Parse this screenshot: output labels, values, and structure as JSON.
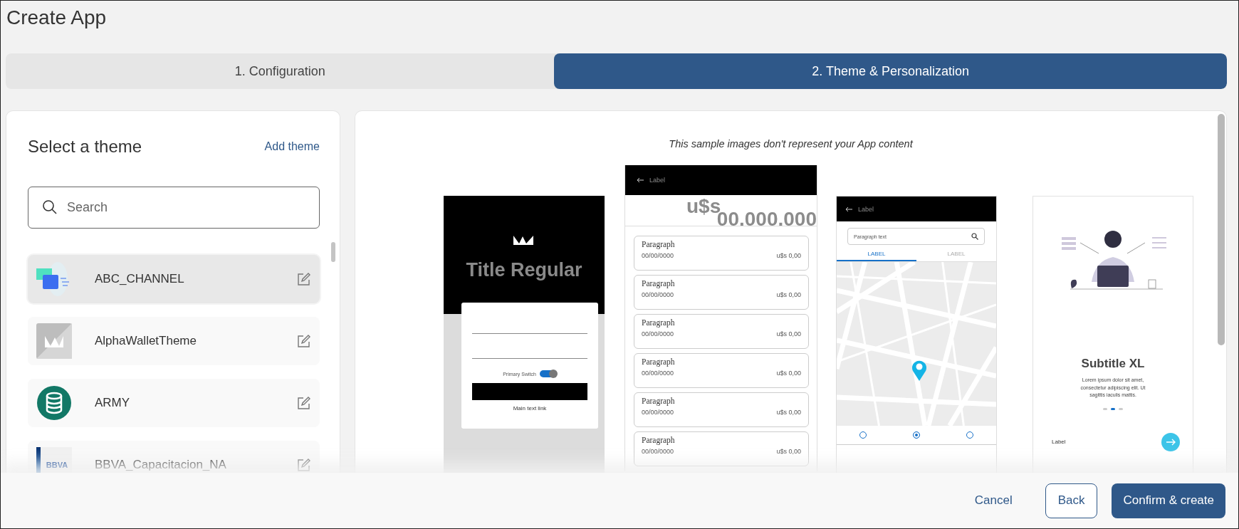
{
  "title": "Create App",
  "steps": [
    {
      "label": "1. Configuration",
      "selected": false
    },
    {
      "label": "2. Theme & Personalization",
      "selected": true
    }
  ],
  "theme_panel": {
    "heading": "Select a theme",
    "add_link": "Add theme",
    "search": {
      "placeholder": "Search"
    },
    "themes": [
      {
        "name": "ABC_CHANNEL",
        "kind": "cards",
        "selected": true
      },
      {
        "name": "AlphaWalletTheme",
        "kind": "crown",
        "selected": false
      },
      {
        "name": "ARMY",
        "kind": "database",
        "selected": false
      },
      {
        "name": "BBVA_Capacitacion_NA",
        "kind": "logo",
        "logo_text": "BBVA",
        "selected": false
      }
    ]
  },
  "preview": {
    "caption": "This sample images don't represent your App content",
    "screens": [
      {
        "kind": "login",
        "title": "Title Regular",
        "switch_label": "Primary Switch",
        "switch_on": true,
        "link": "Main text link"
      },
      {
        "kind": "list",
        "header": "Label",
        "currency": "u$s",
        "amount": "00.000.000",
        "rows": [
          {
            "title": "Paragraph",
            "date": "00/00/0000",
            "value": "u$s 0,00"
          },
          {
            "title": "Paragraph",
            "date": "00/00/0000",
            "value": "u$s 0,00"
          },
          {
            "title": "Paragraph",
            "date": "00/00/0000",
            "value": "u$s 0,00"
          },
          {
            "title": "Paragraph",
            "date": "00/00/0000",
            "value": "u$s 0,00"
          },
          {
            "title": "Paragraph",
            "date": "00/00/0000",
            "value": "u$s 0,00"
          },
          {
            "title": "Paragraph",
            "date": "00/00/0000",
            "value": "u$s 0,00"
          }
        ]
      },
      {
        "kind": "map",
        "header": "Label",
        "search_placeholder": "Paragraph text",
        "tabs": [
          {
            "label": "LABEL",
            "selected": true
          },
          {
            "label": "LABEL",
            "selected": false
          }
        ],
        "nav": [
          {
            "selected": false
          },
          {
            "selected": true
          },
          {
            "selected": false
          }
        ]
      },
      {
        "kind": "onboarding",
        "subtitle": "Subtitle XL",
        "text": "Lorem ipsum dolor sit amet, consectetur adipiscing elit. Ut sagittis iaculis mattis.",
        "dots": [
          {
            "selected": false
          },
          {
            "selected": true
          },
          {
            "selected": false
          }
        ],
        "label": "Label"
      }
    ]
  },
  "footer": {
    "cancel": "Cancel",
    "back": "Back",
    "confirm": "Confirm & create"
  }
}
